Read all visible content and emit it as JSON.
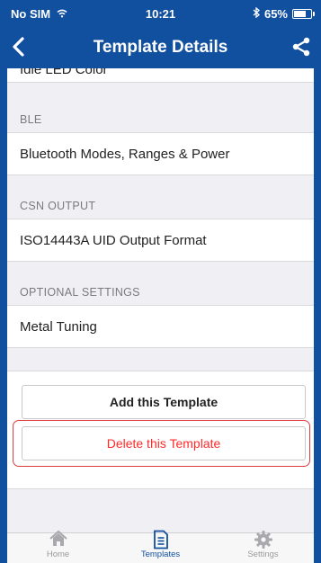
{
  "status_bar": {
    "carrier": "No SIM",
    "time": "10:21",
    "battery": "65%",
    "battery_level": 0.65
  },
  "nav": {
    "title": "Template Details"
  },
  "sections": {
    "partial_row": "Idle LED Color",
    "ble_header": "BLE",
    "ble_row": "Bluetooth Modes, Ranges & Power",
    "csn_header": "CSN OUTPUT",
    "csn_row": "ISO14443A UID Output Format",
    "optional_header": "OPTIONAL SETTINGS",
    "optional_row": "Metal Tuning"
  },
  "actions": {
    "add_label": "Add this Template",
    "delete_label": "Delete this Template"
  },
  "tabbar": {
    "home": "Home",
    "templates": "Templates",
    "settings": "Settings"
  },
  "colors": {
    "accent": "#114f9f",
    "delete_text": "#ff2a2a",
    "highlight": "#e03c3c"
  }
}
